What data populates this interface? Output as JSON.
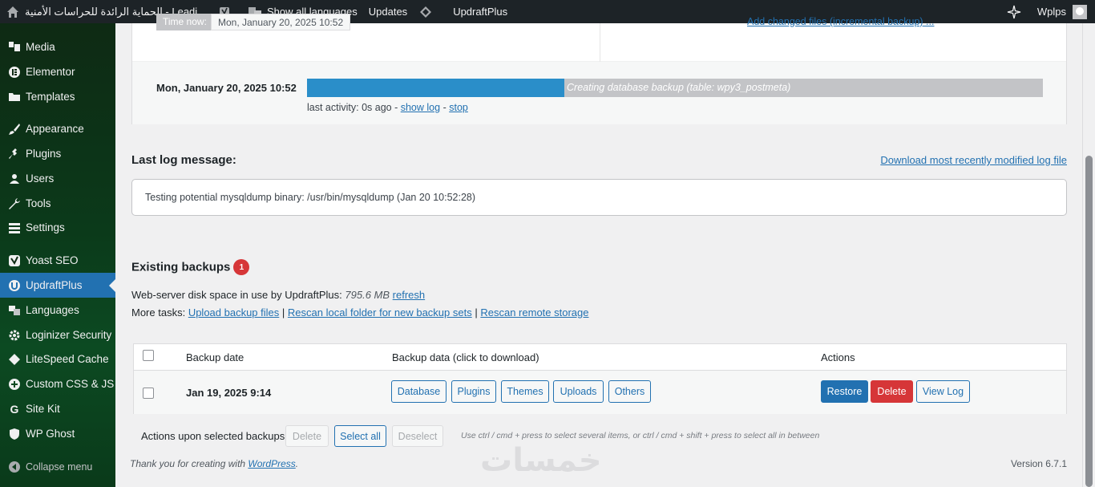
{
  "adminbar": {
    "site_name": "الحماية الرائدة للحراسات الأمنية - Leadi...",
    "show_languages": "Show all languages",
    "updates": "Updates",
    "updraftplus": "UpdraftPlus",
    "user": "Wplps"
  },
  "sidebar": {
    "items": [
      {
        "label": "Media",
        "icon": "media-icon"
      },
      {
        "label": "Elementor",
        "icon": "elementor-icon"
      },
      {
        "label": "Templates",
        "icon": "folder-icon"
      },
      {
        "label": "Appearance",
        "icon": "brush-icon"
      },
      {
        "label": "Plugins",
        "icon": "plug-icon"
      },
      {
        "label": "Users",
        "icon": "user-icon"
      },
      {
        "label": "Tools",
        "icon": "wrench-icon"
      },
      {
        "label": "Settings",
        "icon": "settings-icon"
      },
      {
        "label": "Yoast SEO",
        "icon": "yoast-icon"
      },
      {
        "label": "UpdraftPlus",
        "icon": "updraft-icon"
      },
      {
        "label": "Languages",
        "icon": "translate-icon"
      },
      {
        "label": "Loginizer Security",
        "icon": "gear-icon"
      },
      {
        "label": "LiteSpeed Cache",
        "icon": "diamond-icon"
      },
      {
        "label": "Custom CSS & JS",
        "icon": "plus-circle-icon"
      },
      {
        "label": "Site Kit",
        "icon": "g-icon"
      },
      {
        "label": "WP Ghost",
        "icon": "shield-icon"
      }
    ],
    "collapse": "Collapse menu"
  },
  "top_panel": {
    "time_now_label": "Time now:",
    "time_now_value": "Mon, January 20, 2025 10:52",
    "add_changed_link": "Add changed files (incremental backup) ..."
  },
  "job": {
    "date": "Mon, January 20, 2025 10:52",
    "progress_percent": 35,
    "progress_text": "Creating database backup (table: wpy3_postmeta)",
    "activity_prefix": "last activity: 0s ago -",
    "show_log": "show log",
    "sep": "-",
    "stop": "stop"
  },
  "log": {
    "title": "Last log message:",
    "download_link": "Download most recently modified log file",
    "message": "Testing potential mysqldump binary: /usr/bin/mysqldump (Jan 20 10:52:28)"
  },
  "existing": {
    "title": "Existing backups",
    "count": "1",
    "disk_label": "Web-server disk space in use by UpdraftPlus:",
    "disk_value": "795.6 MB",
    "refresh": "refresh",
    "tasks_label": "More tasks:",
    "upload": "Upload backup files",
    "pipe": "|",
    "rescan_local": "Rescan local folder for new backup sets",
    "rescan_remote": "Rescan remote storage"
  },
  "table": {
    "col_date": "Backup date",
    "col_data": "Backup data (click to download)",
    "col_actions": "Actions",
    "row": {
      "date": "Jan 19, 2025 9:14",
      "data_buttons": [
        "Database",
        "Plugins",
        "Themes",
        "Uploads",
        "Others"
      ],
      "restore": "Restore",
      "delete": "Delete",
      "view_log": "View Log"
    }
  },
  "bulk": {
    "label": "Actions upon selected backups",
    "delete": "Delete",
    "select_all": "Select all",
    "deselect": "Deselect",
    "hint": "Use ctrl / cmd + press to select several items, or ctrl / cmd + shift + press to select all in between"
  },
  "footer": {
    "thanks_prefix": "Thank you for creating with",
    "wordpress": "WordPress",
    "thanks_suffix": ".",
    "version": "Version 6.7.1",
    "watermark": "خمسات"
  },
  "colors": {
    "accent": "#2271b1",
    "progress": "#2a8ec9",
    "danger": "#d63638",
    "adminbar": "#1d2327"
  }
}
